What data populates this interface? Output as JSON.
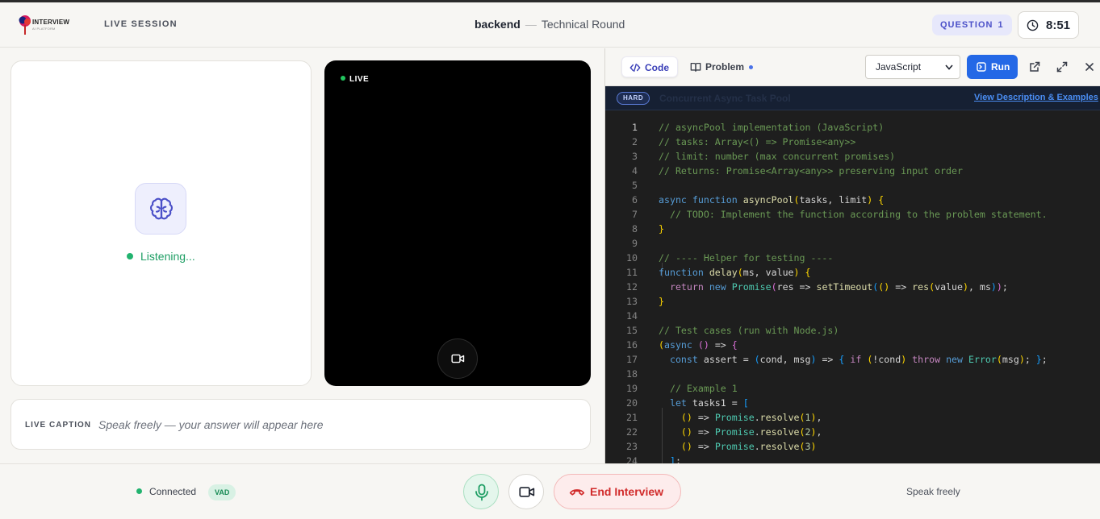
{
  "header": {
    "logo_text": "INTERVIEW",
    "logo_subtext": "AI PLATFORM",
    "session_label": "LIVE SESSION",
    "title_main": "backend",
    "title_separator": "—",
    "title_sub": "Technical Round",
    "question_label": "QUESTION",
    "question_number": "1",
    "timer": "8:51"
  },
  "agent": {
    "icon": "brain-icon",
    "status": "Listening..."
  },
  "video": {
    "live_label": "LIVE",
    "camera_icon": "video-camera-icon"
  },
  "caption": {
    "label": "LIVE CAPTION",
    "placeholder": "Speak freely — your answer will appear here"
  },
  "editor": {
    "tabs": [
      {
        "label": "Code",
        "icon": "code-icon",
        "active": true
      },
      {
        "label": "Problem",
        "icon": "book-icon",
        "active": false
      }
    ],
    "language": "JavaScript",
    "run_label": "Run",
    "difficulty": "HARD",
    "problem_title": "Concurrent Async Task Pool",
    "view_link": "View Description & Examples",
    "active_line": 1,
    "lines": [
      {
        "n": "1",
        "seg": [
          [
            "// asyncPool implementation (JavaScript)",
            "#6a9955"
          ]
        ]
      },
      {
        "n": "2",
        "seg": [
          [
            "// tasks: Array<() => Promise<any>>",
            "#6a9955"
          ]
        ]
      },
      {
        "n": "3",
        "seg": [
          [
            "// limit: number (max concurrent promises)",
            "#6a9955"
          ]
        ]
      },
      {
        "n": "4",
        "seg": [
          [
            "// Returns: Promise<Array<any>> preserving input order",
            "#6a9955"
          ]
        ]
      },
      {
        "n": "5",
        "seg": []
      },
      {
        "n": "6",
        "seg": [
          [
            "async ",
            "#569cd6"
          ],
          [
            "function ",
            "#569cd6"
          ],
          [
            "asyncPool",
            "#dcdcaa"
          ],
          [
            "(",
            "#ffd700"
          ],
          [
            "tasks, limit",
            "#d4d4d4"
          ],
          [
            ")",
            "#ffd700"
          ],
          [
            " ",
            "#d4d4d4"
          ],
          [
            "{",
            "#ffd700"
          ]
        ]
      },
      {
        "n": "7",
        "seg": [
          [
            "  // TODO: Implement the function according to the problem statement.",
            "#6a9955"
          ]
        ]
      },
      {
        "n": "8",
        "seg": [
          [
            "}",
            "#ffd700"
          ]
        ]
      },
      {
        "n": "9",
        "seg": []
      },
      {
        "n": "10",
        "seg": [
          [
            "// ---- Helper for testing ----",
            "#6a9955"
          ]
        ]
      },
      {
        "n": "11",
        "seg": [
          [
            "function ",
            "#569cd6"
          ],
          [
            "delay",
            "#dcdcaa"
          ],
          [
            "(",
            "#ffd700"
          ],
          [
            "ms, value",
            "#d4d4d4"
          ],
          [
            ")",
            "#ffd700"
          ],
          [
            " ",
            "#d4d4d4"
          ],
          [
            "{",
            "#ffd700"
          ]
        ]
      },
      {
        "n": "12",
        "seg": [
          [
            "  return ",
            "#c586c0"
          ],
          [
            "new ",
            "#569cd6"
          ],
          [
            "Promise",
            "#4ec9b0"
          ],
          [
            "(",
            "#da70d6"
          ],
          [
            "res => ",
            "#d4d4d4"
          ],
          [
            "setTimeout",
            "#dcdcaa"
          ],
          [
            "(",
            "#179fff"
          ],
          [
            "()",
            "#ffd700"
          ],
          [
            " => ",
            "#d4d4d4"
          ],
          [
            "res",
            "#dcdcaa"
          ],
          [
            "(",
            "#ffd700"
          ],
          [
            "value",
            "#d4d4d4"
          ],
          [
            ")",
            "#ffd700"
          ],
          [
            ", ms",
            "#d4d4d4"
          ],
          [
            ")",
            "#179fff"
          ],
          [
            ")",
            "#da70d6"
          ],
          [
            ";",
            "#d4d4d4"
          ]
        ]
      },
      {
        "n": "13",
        "seg": [
          [
            "}",
            "#ffd700"
          ]
        ]
      },
      {
        "n": "14",
        "seg": []
      },
      {
        "n": "15",
        "seg": [
          [
            "// Test cases (run with Node.js)",
            "#6a9955"
          ]
        ]
      },
      {
        "n": "16",
        "seg": [
          [
            "(",
            "#ffd700"
          ],
          [
            "async ",
            "#569cd6"
          ],
          [
            "()",
            "#da70d6"
          ],
          [
            " => ",
            "#d4d4d4"
          ],
          [
            "{",
            "#da70d6"
          ]
        ]
      },
      {
        "n": "17",
        "seg": [
          [
            "  const ",
            "#569cd6"
          ],
          [
            "assert = ",
            "#d4d4d4"
          ],
          [
            "(",
            "#179fff"
          ],
          [
            "cond, msg",
            "#d4d4d4"
          ],
          [
            ")",
            "#179fff"
          ],
          [
            " => ",
            "#d4d4d4"
          ],
          [
            "{ ",
            "#179fff"
          ],
          [
            "if ",
            "#c586c0"
          ],
          [
            "(",
            "#ffd700"
          ],
          [
            "!cond",
            "#d4d4d4"
          ],
          [
            ")",
            "#ffd700"
          ],
          [
            " ",
            "#d4d4d4"
          ],
          [
            "throw ",
            "#c586c0"
          ],
          [
            "new ",
            "#569cd6"
          ],
          [
            "Error",
            "#4ec9b0"
          ],
          [
            "(",
            "#ffd700"
          ],
          [
            "msg",
            "#d4d4d4"
          ],
          [
            ")",
            "#ffd700"
          ],
          [
            "; ",
            "#d4d4d4"
          ],
          [
            "}",
            "#179fff"
          ],
          [
            ";",
            "#d4d4d4"
          ]
        ]
      },
      {
        "n": "18",
        "seg": []
      },
      {
        "n": "19",
        "seg": [
          [
            "  // Example 1",
            "#6a9955"
          ]
        ]
      },
      {
        "n": "20",
        "seg": [
          [
            "  let ",
            "#569cd6"
          ],
          [
            "tasks1 = ",
            "#d4d4d4"
          ],
          [
            "[",
            "#179fff"
          ]
        ]
      },
      {
        "n": "21",
        "seg": [
          [
            "    ",
            "#d4d4d4"
          ],
          [
            "()",
            "#ffd700"
          ],
          [
            " => ",
            "#d4d4d4"
          ],
          [
            "Promise",
            "#4ec9b0"
          ],
          [
            ".",
            "#d4d4d4"
          ],
          [
            "resolve",
            "#dcdcaa"
          ],
          [
            "(",
            "#ffd700"
          ],
          [
            "1",
            "#b5cea8"
          ],
          [
            ")",
            "#ffd700"
          ],
          [
            ",",
            "#d4d4d4"
          ]
        ]
      },
      {
        "n": "22",
        "seg": [
          [
            "    ",
            "#d4d4d4"
          ],
          [
            "()",
            "#ffd700"
          ],
          [
            " => ",
            "#d4d4d4"
          ],
          [
            "Promise",
            "#4ec9b0"
          ],
          [
            ".",
            "#d4d4d4"
          ],
          [
            "resolve",
            "#dcdcaa"
          ],
          [
            "(",
            "#ffd700"
          ],
          [
            "2",
            "#b5cea8"
          ],
          [
            ")",
            "#ffd700"
          ],
          [
            ",",
            "#d4d4d4"
          ]
        ]
      },
      {
        "n": "23",
        "seg": [
          [
            "    ",
            "#d4d4d4"
          ],
          [
            "()",
            "#ffd700"
          ],
          [
            " => ",
            "#d4d4d4"
          ],
          [
            "Promise",
            "#4ec9b0"
          ],
          [
            ".",
            "#d4d4d4"
          ],
          [
            "resolve",
            "#dcdcaa"
          ],
          [
            "(",
            "#ffd700"
          ],
          [
            "3",
            "#b5cea8"
          ],
          [
            ")",
            "#ffd700"
          ]
        ]
      },
      {
        "n": "24",
        "seg": [
          [
            "  ",
            "#d4d4d4"
          ],
          [
            "]",
            "#179fff"
          ],
          [
            ";",
            "#d4d4d4"
          ]
        ]
      }
    ]
  },
  "footer": {
    "connection_status": "Connected",
    "vad_badge": "VAD",
    "mic_icon": "microphone-icon",
    "camera_icon": "video-camera-icon",
    "end_label": "End Interview",
    "end_icon": "phone-hangup-icon",
    "hint": "Speak freely"
  },
  "colors": {
    "accent": "#2468e6",
    "success": "#22b36f",
    "danger": "#d12b2b",
    "editor_bg": "#1e1e1e",
    "indigo": "#4b50c8"
  }
}
